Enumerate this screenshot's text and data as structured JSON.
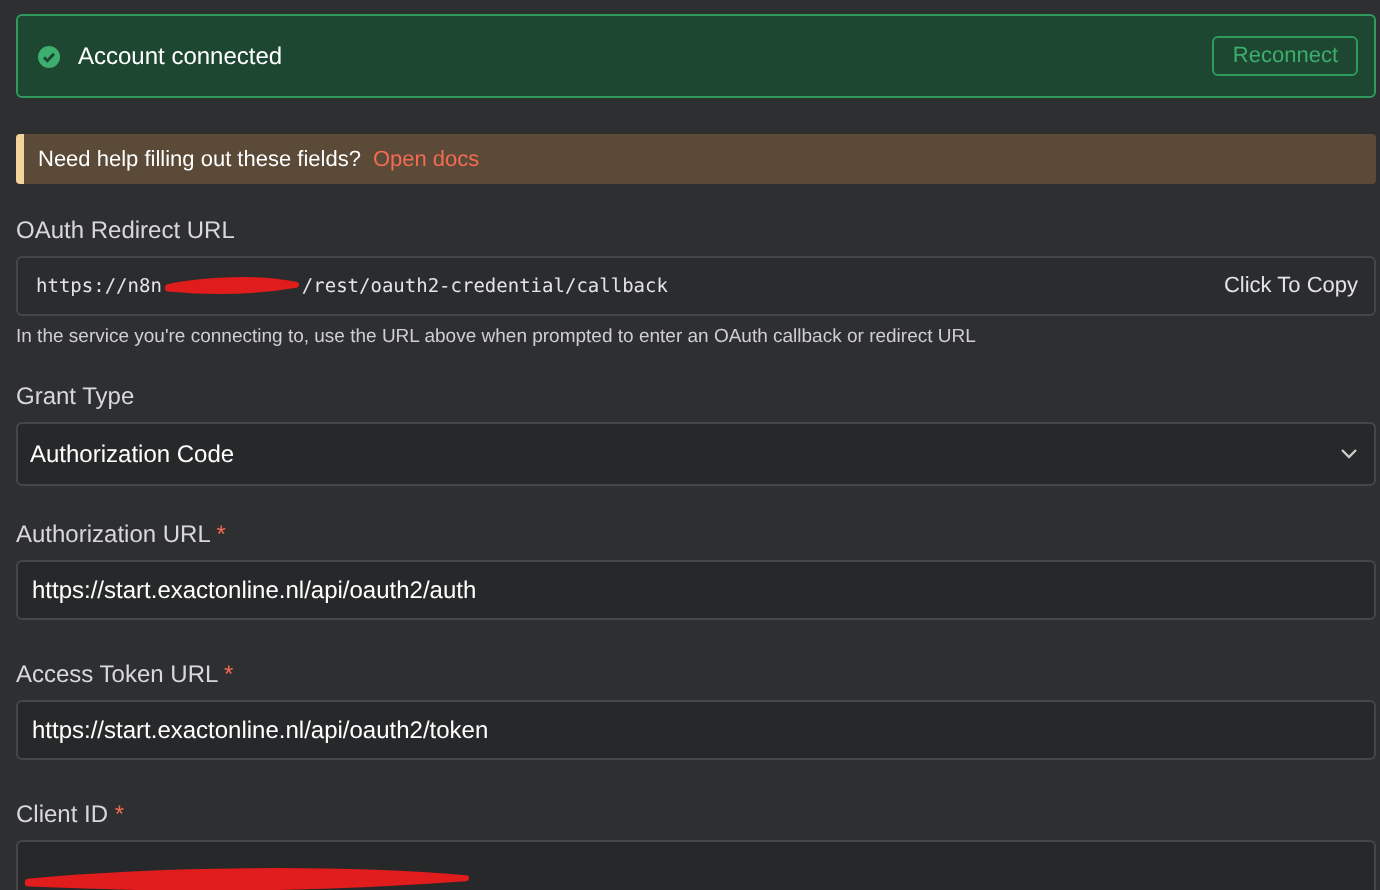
{
  "banner": {
    "message": "Account connected",
    "button": "Reconnect"
  },
  "help": {
    "text": "Need help filling out these fields?",
    "link": "Open docs"
  },
  "fields": [
    {
      "kind": "copy",
      "label": "OAuth Redirect URL",
      "value_start": "https://n8n",
      "value_end": "/rest/oauth2-credential/callback",
      "action": "Click To Copy",
      "hint": "In the service you're connecting to, use the URL above when prompted to enter an OAuth callback or redirect URL"
    },
    {
      "kind": "select",
      "label": "Grant Type",
      "value": "Authorization Code"
    },
    {
      "kind": "text",
      "label": "Authorization URL",
      "required_mark": "*",
      "value": "https://start.exactonline.nl/api/oauth2/auth"
    },
    {
      "kind": "text",
      "label": "Access Token URL",
      "required_mark": "*",
      "value": "https://start.exactonline.nl/api/oauth2/token"
    },
    {
      "kind": "redacted",
      "label": "Client ID",
      "required_mark": "*"
    }
  ]
}
